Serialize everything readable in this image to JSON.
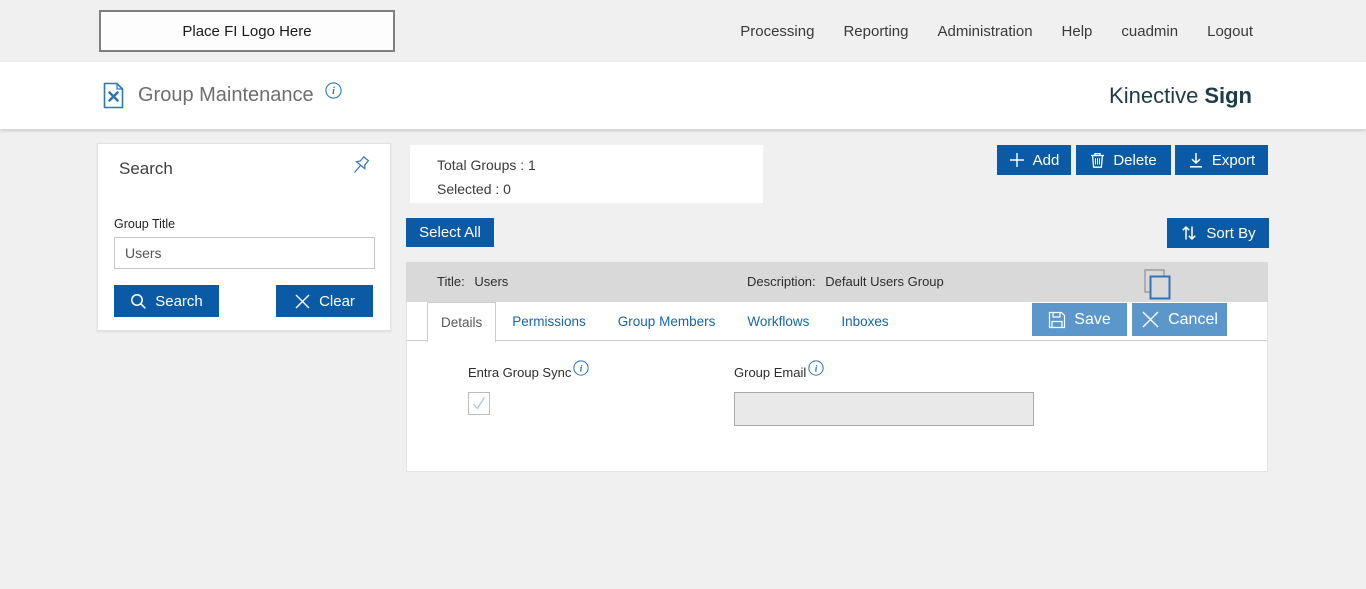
{
  "topbar": {
    "logo_placeholder": "Place FI Logo Here",
    "nav": [
      "Processing",
      "Reporting",
      "Administration",
      "Help",
      "cuadmin",
      "Logout"
    ]
  },
  "header": {
    "title": "Group Maintenance",
    "brand": "Kinective",
    "brand_bold": "Sign"
  },
  "search_panel": {
    "title": "Search",
    "group_title_label": "Group Title",
    "group_title_value": "Users",
    "search_button": "Search",
    "clear_button": "Clear"
  },
  "summary": {
    "total_groups_label": "Total Groups :",
    "total_groups_value": "1",
    "selected_label": "Selected :",
    "selected_value": "0"
  },
  "toolbar": {
    "add": "Add",
    "delete": "Delete",
    "export": "Export"
  },
  "list_controls": {
    "select_all": "Select All",
    "sort_by": "Sort By"
  },
  "group_row": {
    "title_label": "Title:",
    "title_value": "Users",
    "description_label": "Description:",
    "description_value": "Default Users Group"
  },
  "tabs": [
    "Details",
    "Permissions",
    "Group Members",
    "Workflows",
    "Inboxes"
  ],
  "active_tab": "Details",
  "form_actions": {
    "save": "Save",
    "cancel": "Cancel"
  },
  "details": {
    "entra_group_sync_label": "Entra Group Sync",
    "entra_group_sync_checked": true,
    "group_email_label": "Group Email",
    "group_email_value": ""
  },
  "icons": [
    "document-tools-icon",
    "info-icon",
    "pin-icon",
    "search-icon",
    "x-icon",
    "plus-icon",
    "trash-icon",
    "download-icon",
    "sort-arrows-icon",
    "copy-icon",
    "save-floppy-icon",
    "check-icon"
  ],
  "colors": {
    "primary_blue": "#0b5aa6",
    "muted_blue": "#5b97cb",
    "brand_teal": "#1d3c46",
    "link_blue": "#1665ad",
    "icon_blue": "#2e75b6",
    "row_gray": "#d9d9d9",
    "page_bg": "#f0f0f0"
  }
}
